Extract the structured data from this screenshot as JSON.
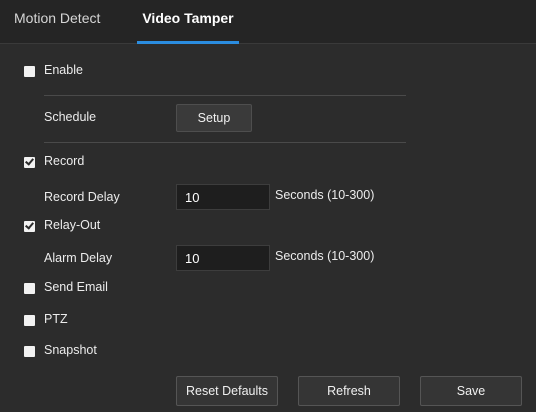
{
  "tabs": [
    {
      "label": "Motion Detect",
      "active": false
    },
    {
      "label": "Video Tamper",
      "active": true
    }
  ],
  "enable": {
    "label": "Enable",
    "checked": false
  },
  "schedule": {
    "label": "Schedule",
    "button_label": "Setup"
  },
  "record": {
    "label": "Record",
    "checked": true
  },
  "record_delay": {
    "label": "Record Delay",
    "value": "10",
    "hint": "Seconds (10-300)"
  },
  "relay_out": {
    "label": "Relay-Out",
    "checked": true
  },
  "alarm_delay": {
    "label": "Alarm Delay",
    "value": "10",
    "hint": "Seconds (10-300)"
  },
  "send_email": {
    "label": "Send Email",
    "checked": false
  },
  "ptz": {
    "label": "PTZ",
    "checked": false
  },
  "snapshot": {
    "label": "Snapshot",
    "checked": false
  },
  "footer": {
    "reset_label": "Reset Defaults",
    "refresh_label": "Refresh",
    "save_label": "Save"
  },
  "colors": {
    "accent": "#2b8de0",
    "background": "#2c2c2c",
    "input_background": "#1e1e1e"
  },
  "icons": {
    "checked": "checkbox-checked-icon",
    "unchecked": "checkbox-unchecked-icon"
  }
}
